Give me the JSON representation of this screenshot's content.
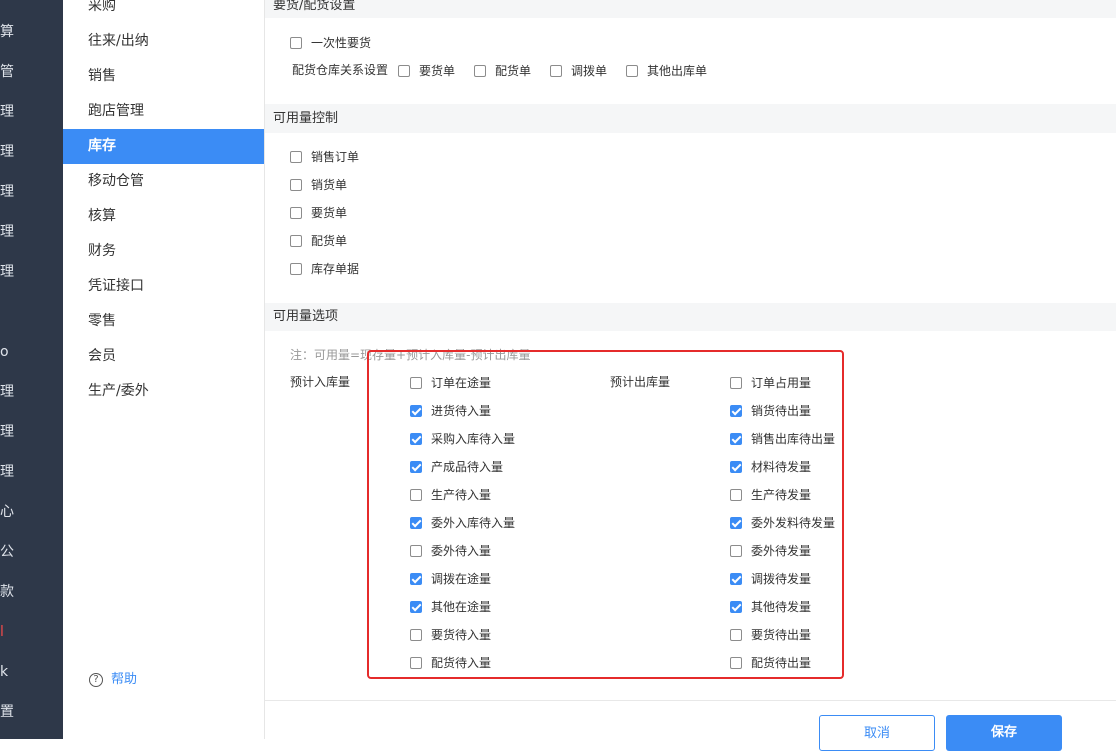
{
  "left_nav": {
    "fragments": [
      "算",
      "管",
      "理",
      "理",
      "理",
      "理",
      "理",
      "o",
      "理",
      "理",
      "理",
      "心",
      "公",
      "款",
      "l",
      "k",
      "置"
    ]
  },
  "sub_nav": {
    "items": [
      "采购",
      "往来/出纳",
      "销售",
      "跑店管理",
      "库存",
      "移动仓管",
      "核算",
      "财务",
      "凭证接口",
      "零售",
      "会员",
      "生产/委外"
    ],
    "active": "库存",
    "help": "帮助"
  },
  "sections": {
    "request": {
      "title": "要货/配货设置",
      "one_time": "一次性要货",
      "warehouse_label": "配货仓库关系设置",
      "warehouse_options": [
        "要货单",
        "配货单",
        "调拨单",
        "其他出库单"
      ]
    },
    "avail_control": {
      "title": "可用量控制",
      "items": [
        "销售订单",
        "销货单",
        "要货单",
        "配货单",
        "库存单据"
      ]
    },
    "avail_options": {
      "title": "可用量选项",
      "note": "注：可用量=现存量+预计入库量-预计出库量",
      "in_label": "预计入库量",
      "out_label": "预计出库量",
      "in_items": [
        {
          "label": "订单在途量",
          "checked": false
        },
        {
          "label": "进货待入量",
          "checked": true
        },
        {
          "label": "采购入库待入量",
          "checked": true
        },
        {
          "label": "产成品待入量",
          "checked": true
        },
        {
          "label": "生产待入量",
          "checked": false
        },
        {
          "label": "委外入库待入量",
          "checked": true
        },
        {
          "label": "委外待入量",
          "checked": false
        },
        {
          "label": "调拨在途量",
          "checked": true
        },
        {
          "label": "其他在途量",
          "checked": true
        },
        {
          "label": "要货待入量",
          "checked": false
        },
        {
          "label": "配货待入量",
          "checked": false
        }
      ],
      "out_items": [
        {
          "label": "订单占用量",
          "checked": false
        },
        {
          "label": "销货待出量",
          "checked": true
        },
        {
          "label": "销售出库待出量",
          "checked": true
        },
        {
          "label": "材料待发量",
          "checked": true
        },
        {
          "label": "生产待发量",
          "checked": false
        },
        {
          "label": "委外发料待发量",
          "checked": true
        },
        {
          "label": "委外待发量",
          "checked": false
        },
        {
          "label": "调拨待发量",
          "checked": true
        },
        {
          "label": "其他待发量",
          "checked": true
        },
        {
          "label": "要货待出量",
          "checked": false
        },
        {
          "label": "配货待出量",
          "checked": false
        }
      ]
    }
  },
  "footer": {
    "cancel": "取消",
    "save": "保存"
  },
  "colors": {
    "accent": "#3b8cf5",
    "nav_bg": "#2e3849",
    "highlight_box": "#e52b2b"
  }
}
